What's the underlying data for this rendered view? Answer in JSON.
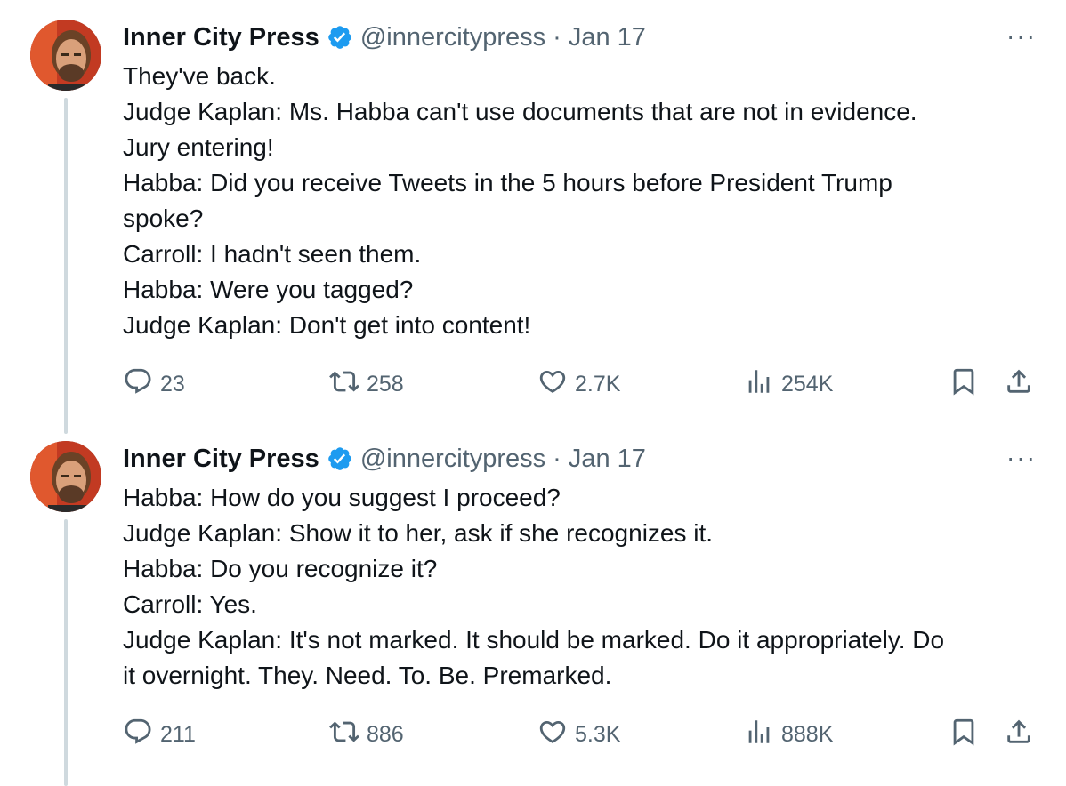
{
  "tweets": [
    {
      "author_name": "Inner City Press",
      "handle": "@innercitypress",
      "separator": "·",
      "date": "Jan 17",
      "more_label": "···",
      "lines": [
        "They've back.",
        "Judge Kaplan: Ms. Habba can't use documents that are not in evidence.",
        "Jury entering!",
        "Habba: Did you receive Tweets in the 5 hours before President Trump",
        "spoke?",
        "Carroll: I hadn't seen them.",
        "Habba: Were you tagged?",
        "Judge Kaplan: Don't get into content!"
      ],
      "replies": "23",
      "reposts": "258",
      "likes": "2.7K",
      "views": "254K"
    },
    {
      "author_name": "Inner City Press",
      "handle": "@innercitypress",
      "separator": "·",
      "date": "Jan 17",
      "more_label": "···",
      "lines": [
        "Habba: How do you suggest I proceed?",
        "Judge Kaplan: Show it to her, ask if she recognizes it.",
        "Habba: Do you recognize it?",
        "Carroll: Yes.",
        "Judge Kaplan: It's not marked. It should be marked. Do it appropriately. Do",
        "it overnight. They. Need. To. Be. Premarked."
      ],
      "replies": "211",
      "reposts": "886",
      "likes": "5.3K",
      "views": "888K"
    }
  ],
  "colors": {
    "text": "#0f1419",
    "secondary": "#536471",
    "verified": "#1d9bf0",
    "thread_line": "#cfd9de"
  },
  "icons": [
    "verified-badge-icon",
    "more-icon",
    "reply-icon",
    "repost-icon",
    "like-icon",
    "views-icon",
    "bookmark-icon",
    "share-icon"
  ]
}
